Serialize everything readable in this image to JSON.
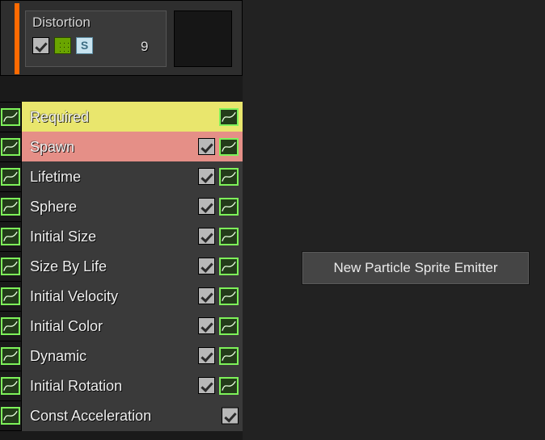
{
  "emitter": {
    "title": "Distortion",
    "count": "9",
    "s_label": "S"
  },
  "modules": [
    {
      "label": "Required",
      "bg": "yellow",
      "has_check": false,
      "has_curve": true
    },
    {
      "label": "Spawn",
      "bg": "red",
      "has_check": true,
      "has_curve": true
    },
    {
      "label": "Lifetime",
      "bg": "",
      "has_check": true,
      "has_curve": true
    },
    {
      "label": "Sphere",
      "bg": "",
      "has_check": true,
      "has_curve": true
    },
    {
      "label": "Initial Size",
      "bg": "",
      "has_check": true,
      "has_curve": true
    },
    {
      "label": "Size By Life",
      "bg": "",
      "has_check": true,
      "has_curve": true
    },
    {
      "label": "Initial Velocity",
      "bg": "",
      "has_check": true,
      "has_curve": true
    },
    {
      "label": "Initial Color",
      "bg": "",
      "has_check": true,
      "has_curve": true
    },
    {
      "label": "Dynamic",
      "bg": "",
      "has_check": true,
      "has_curve": true
    },
    {
      "label": "Initial Rotation",
      "bg": "",
      "has_check": true,
      "has_curve": true
    },
    {
      "label": "Const Acceleration",
      "bg": "",
      "has_check": true,
      "has_curve": false
    }
  ],
  "context_menu": {
    "item": "New Particle Sprite Emitter"
  }
}
